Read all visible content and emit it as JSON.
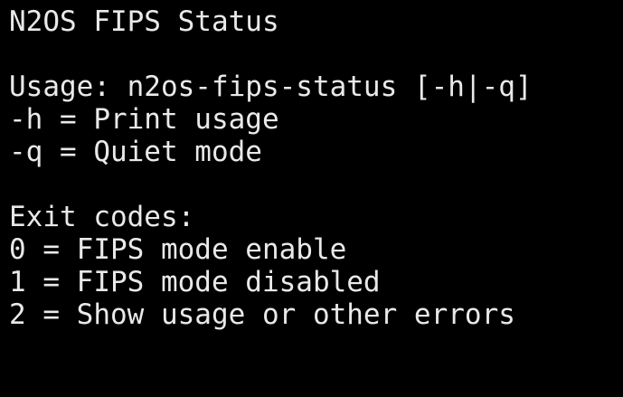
{
  "terminal": {
    "title": "N2OS FIPS Status",
    "usage": "Usage: n2os-fips-status [-h|-q]",
    "options": [
      "-h = Print usage",
      "-q = Quiet mode"
    ],
    "exit_heading": "Exit codes:",
    "exit_codes": [
      "0 = FIPS mode enable",
      "1 = FIPS mode disabled",
      "2 = Show usage or other errors"
    ]
  }
}
